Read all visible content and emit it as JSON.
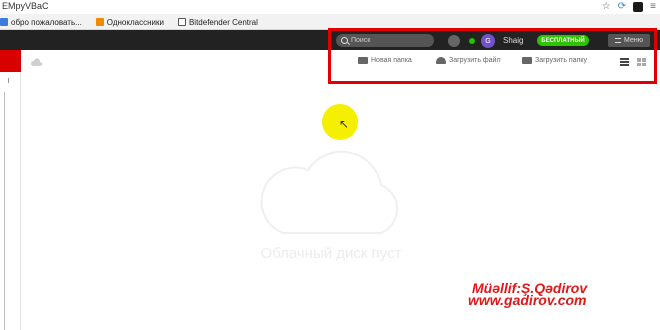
{
  "browser": {
    "url": "EMpyVBaC",
    "bookmarks": [
      {
        "label": "обро пожаловать...",
        "color": "#3b7ddd"
      },
      {
        "label": "Одноклассники",
        "color": "#f08a00"
      },
      {
        "label": "Bitdefender Central",
        "color": "#555555"
      }
    ],
    "icons": [
      "star-icon",
      "refresh-icon",
      "bitdefender-shield-icon",
      "menu-icon"
    ]
  },
  "header": {
    "search_placeholder": "Поиск",
    "avatar_letter": "G",
    "username": "Shaig",
    "plan_badge": "БЕСПЛАТНЫЙ",
    "menu_label": "Меню",
    "online_color": "#21c000",
    "avatar_color": "#7352c8"
  },
  "actions": {
    "new_folder": "Новая папка",
    "upload_file": "Загрузить файл",
    "upload_folder": "Загрузить папку"
  },
  "empty_state": {
    "message": "Облачный диск пуст"
  },
  "watermark": {
    "line1": "Müəllif:Ş.Qədirov",
    "line2": "www.gadirov.com"
  },
  "colors": {
    "accent_red": "#d90000",
    "highlight_box": "#e00000",
    "badge_green": "#2ec200"
  }
}
